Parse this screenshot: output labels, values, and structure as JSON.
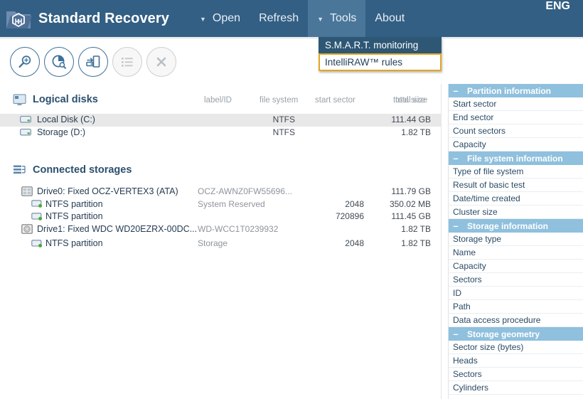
{
  "window": {
    "app_title": "Standard Recovery",
    "logo_icon": "folder-hexagon-logo"
  },
  "menubar": {
    "items": [
      {
        "label": "Open",
        "caret": "▼",
        "has_caret": true,
        "active": false
      },
      {
        "label": "Refresh",
        "caret": "",
        "has_caret": false,
        "active": false
      },
      {
        "label": "Tools",
        "caret": "▼",
        "has_caret": true,
        "active": true
      },
      {
        "label": "About",
        "caret": "",
        "has_caret": false,
        "active": false
      }
    ],
    "language": "ENG",
    "bar_color": "#335f84",
    "active_color": "#4a769a"
  },
  "dropdown": {
    "open_for": "Tools",
    "highlight_color": "#2d5775",
    "selected_border_color": "#e3a622",
    "items": [
      {
        "label": "S.M.A.R.T. monitoring",
        "state": "highlighted"
      },
      {
        "label": "IntelliRAW™ rules",
        "state": "selected"
      }
    ]
  },
  "toolbar": {
    "buttons": [
      {
        "name": "search-disk-button",
        "icon": "magnifier-icon",
        "enabled": true
      },
      {
        "name": "disk-analysis-button",
        "icon": "pie-search-icon",
        "enabled": true
      },
      {
        "name": "create-image-button",
        "icon": "disk-image-icon",
        "enabled": true
      },
      {
        "name": "list-view-button",
        "icon": "list-icon",
        "enabled": false
      },
      {
        "name": "close-button",
        "icon": "close-x-icon",
        "enabled": false
      }
    ]
  },
  "logical_disks": {
    "title": "Logical disks",
    "icon": "monitor-icon",
    "columns": {
      "file_system": "file system",
      "total_size": "total size"
    },
    "rows": [
      {
        "name": "Local Disk (C:)",
        "icon": "drive-icon",
        "file_system": "NTFS",
        "total_size": "111.44 GB",
        "selected": true
      },
      {
        "name": "Storage (D:)",
        "icon": "drive-icon",
        "file_system": "NTFS",
        "total_size": "1.82 TB",
        "selected": false
      }
    ]
  },
  "connected_storages": {
    "title": "Connected storages",
    "icon": "storages-icon",
    "columns": {
      "label_id": "label/ID",
      "start_sector": "start sector",
      "total_size": "total size"
    },
    "rows": [
      {
        "name": "Drive0: Fixed OCZ-VERTEX3 (ATA)",
        "icon": "ssd-icon",
        "level": 0,
        "label_id": "OCZ-AWNZ0FW55696...",
        "start_sector": "",
        "total_size": "111.79 GB"
      },
      {
        "name": "NTFS partition",
        "icon": "partition-icon",
        "level": 1,
        "label_id": "System Reserved",
        "start_sector": "2048",
        "total_size": "350.02 MB"
      },
      {
        "name": "NTFS partition",
        "icon": "partition-icon",
        "level": 1,
        "label_id": "",
        "start_sector": "720896",
        "total_size": "111.45 GB"
      },
      {
        "name": "Drive1: Fixed WDC WD20EZRX-00DC...",
        "icon": "hdd-icon",
        "level": 0,
        "label_id": "WD-WCC1T0239932",
        "start_sector": "",
        "total_size": "1.82 TB"
      },
      {
        "name": "NTFS partition",
        "icon": "partition-icon",
        "level": 1,
        "label_id": "Storage",
        "start_sector": "2048",
        "total_size": "1.82 TB"
      }
    ]
  },
  "sidebar": {
    "group_color": "#8fc0dd",
    "collapse_glyph": "–",
    "groups": [
      {
        "title": "Partition information",
        "rows": [
          "Start sector",
          "End sector",
          "Count sectors",
          "Capacity"
        ]
      },
      {
        "title": "File system information",
        "rows": [
          "Type of file system",
          "Result of basic test",
          "Date/time created",
          "Cluster size"
        ]
      },
      {
        "title": "Storage information",
        "rows": [
          "Storage type",
          "Name",
          "Capacity",
          "Sectors",
          "ID",
          "Path",
          "Data access procedure"
        ]
      },
      {
        "title": "Storage geometry",
        "rows": [
          "Sector size (bytes)",
          "Heads",
          "Sectors",
          "Cylinders"
        ]
      }
    ]
  }
}
